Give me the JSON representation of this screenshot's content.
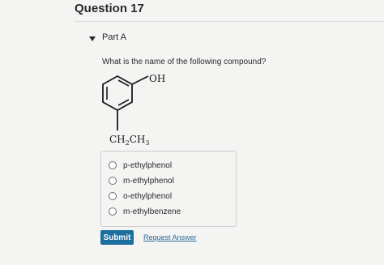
{
  "question": {
    "title": "Question 17"
  },
  "part": {
    "label": "Part A",
    "expanded": true
  },
  "prompt": "What is the name of the following compound?",
  "structure": {
    "top_substituent": "OH",
    "bottom_substituent_main": "CH",
    "bottom_sub_2": "2",
    "bottom_substituent_tail": "CH",
    "bottom_sub_3": "3"
  },
  "options": [
    {
      "label": "p-ethylphenol",
      "selected": false
    },
    {
      "label": "m-ethylphenol",
      "selected": false
    },
    {
      "label": "o-ethylphenol",
      "selected": false
    },
    {
      "label": "m-ethylbenzene",
      "selected": false
    }
  ],
  "actions": {
    "submit_label": "Submit",
    "request_answer_label": "Request Answer"
  },
  "colors": {
    "submit_bg": "#1c6e9d",
    "link": "#2b6a97",
    "background": "#f4f4f3"
  }
}
